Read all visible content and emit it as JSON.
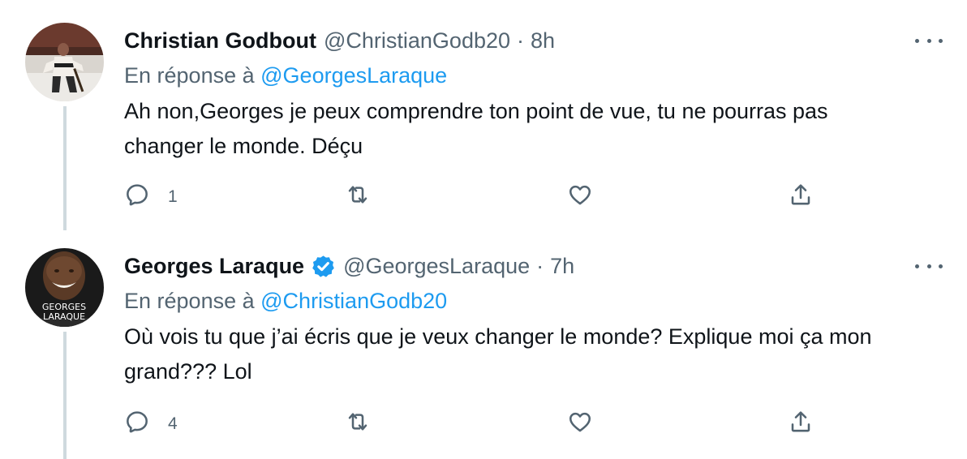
{
  "tweets": [
    {
      "author_name": "Christian Godbout",
      "verified": false,
      "handle": "@ChristianGodb20",
      "separator": "·",
      "time": "8h",
      "reply_prefix": "En réponse à",
      "reply_mention": "@GeorgesLaraque",
      "text_line1": "Ah non,Georges je peux comprendre ton point de vue, tu ne pourras pas",
      "text_line2": "changer le monde. Déçu",
      "reply_count": "1",
      "icons": {
        "reply": "reply-icon",
        "retweet": "retweet-icon",
        "like": "heart-icon",
        "share": "share-icon",
        "more": "more-dots-icon"
      }
    },
    {
      "author_name": "Georges Laraque",
      "verified": true,
      "handle": "@GeorgesLaraque",
      "separator": "·",
      "time": "7h",
      "reply_prefix": "En réponse à",
      "reply_mention": "@ChristianGodb20",
      "text_line1": "Où vois tu que j’ai écris que je veux changer le monde? Explique moi ça mon",
      "text_line2": "grand??? Lol",
      "reply_count": "4",
      "avatar_text_line1": "GEORGES",
      "avatar_text_line2": "LARAQUE",
      "icons": {
        "reply": "reply-icon",
        "retweet": "retweet-icon",
        "like": "heart-icon",
        "share": "share-icon",
        "more": "more-dots-icon",
        "verified": "verified-badge-icon"
      }
    }
  ],
  "colors": {
    "text_primary": "#0f1419",
    "text_secondary": "#536471",
    "accent": "#1d9bf0",
    "thread_line": "#cfd9de"
  }
}
